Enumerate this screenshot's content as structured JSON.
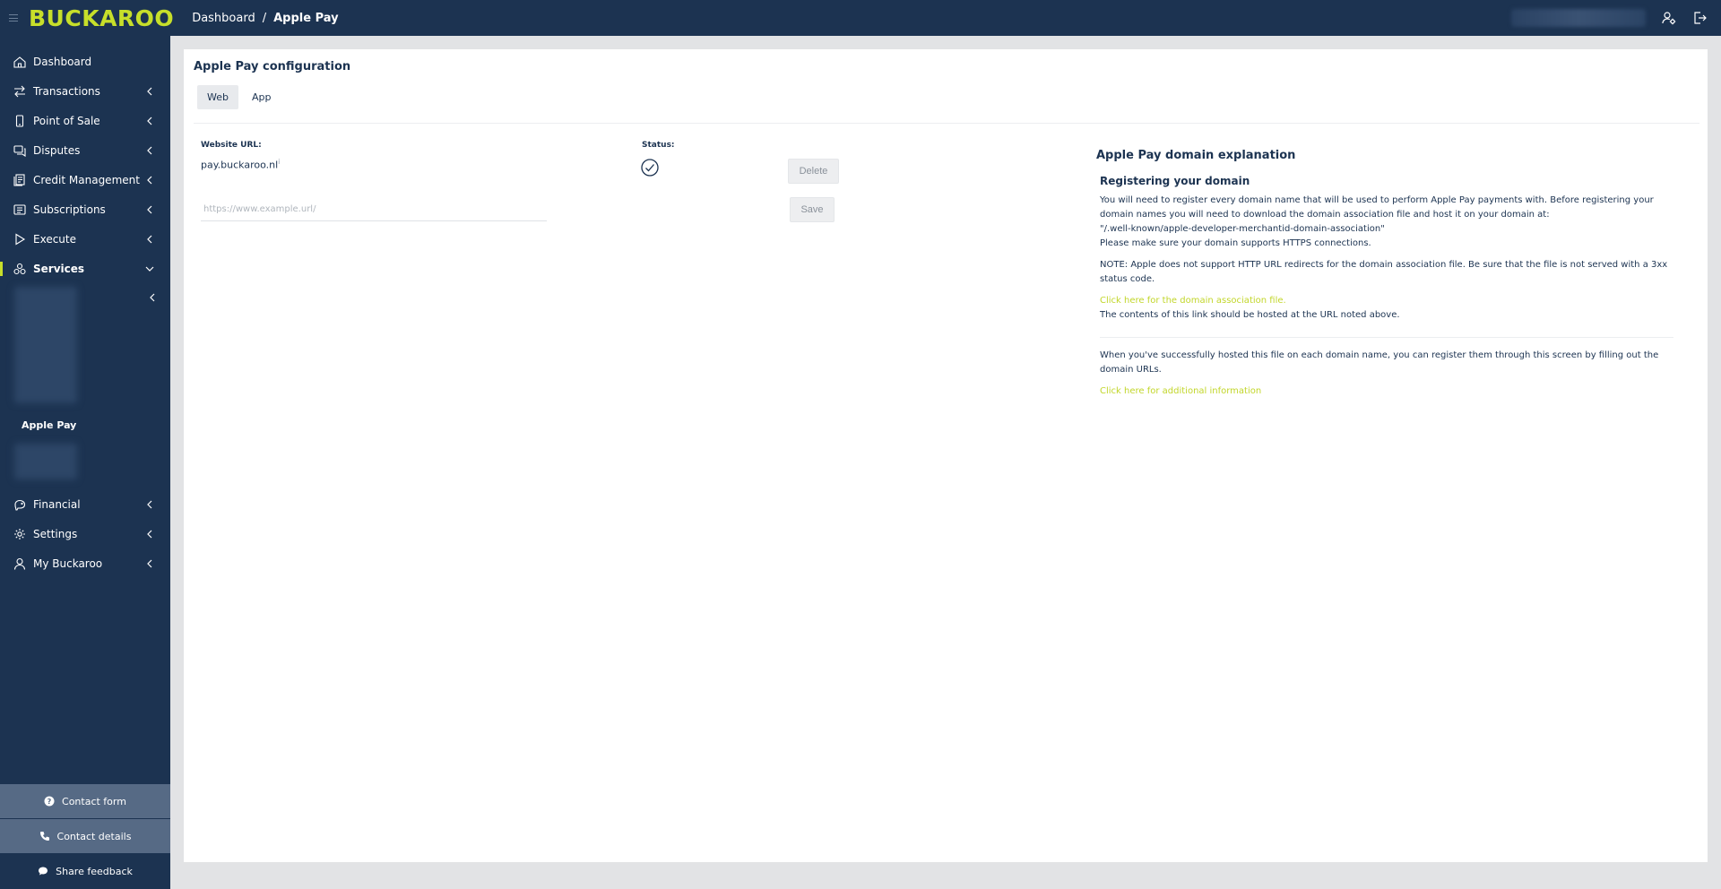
{
  "app": {
    "logo": "BUCKAROO"
  },
  "breadcrumb": {
    "home": "Dashboard",
    "separator": "/",
    "current": "Apple Pay"
  },
  "sidebar": {
    "items": [
      {
        "label": "Dashboard"
      },
      {
        "label": "Transactions"
      },
      {
        "label": "Point of Sale"
      },
      {
        "label": "Disputes"
      },
      {
        "label": "Credit Management"
      },
      {
        "label": "Subscriptions"
      },
      {
        "label": "Execute"
      },
      {
        "label": "Services"
      },
      {
        "label": "Financial"
      },
      {
        "label": "Settings"
      },
      {
        "label": "My Buckaroo"
      }
    ],
    "active_sub_item": "Apple Pay",
    "footer": {
      "contact_form": "Contact form",
      "contact_details": "Contact details",
      "share_feedback": "Share feedback"
    }
  },
  "main": {
    "title": "Apple Pay configuration",
    "tabs": [
      {
        "label": "Web"
      },
      {
        "label": "App"
      }
    ],
    "website_url_label": "Website URL:",
    "website_url_value": "pay.buckaroo.nl",
    "url_info_mark": "i",
    "status_label": "Status:",
    "delete_label": "Delete",
    "save_label": "Save",
    "url_placeholder": "https://www.example.url/"
  },
  "explanation": {
    "title": "Apple Pay domain explanation",
    "subtitle": "Registering your domain",
    "p1": "You will need to register every domain name that will be used to perform Apple Pay payments with. Before registering your domain names you will need to download the domain association file and host it on your domain at:",
    "p1_path": "\"/.well-known/apple-developer-merchantid-domain-association\"",
    "p1_https": "Please make sure your domain supports HTTPS connections.",
    "note": "NOTE: Apple does not support HTTP URL redirects for the domain association file. Be sure that the file is not served with a 3xx status code.",
    "link_file": "Click here for the domain association file.",
    "link_file_caption": "The contents of this link should be hosted at the URL noted above.",
    "p2": "When you've successfully hosted this file on each domain name, you can register them through this screen by filling out the domain URLs.",
    "link_more": "Click here for additional information"
  },
  "colors": {
    "navy": "#1c3351",
    "accent": "#c7df2a",
    "footer": "#566a85"
  }
}
